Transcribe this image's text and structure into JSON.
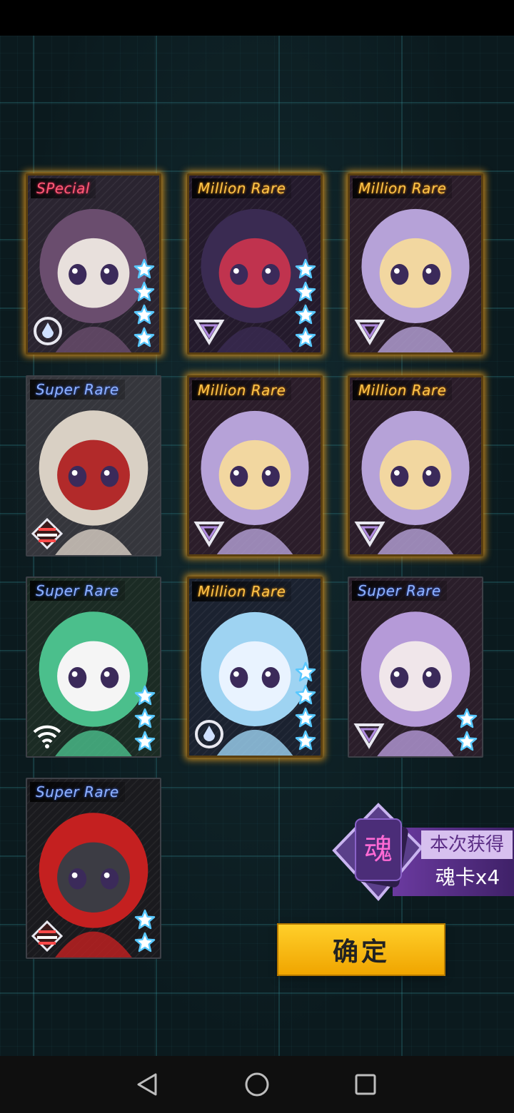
{
  "cards": [
    {
      "rarity": "SPecial",
      "rarity_class": "sp",
      "stars": 4,
      "glow": true,
      "class_icon": "drop-target-icon",
      "palette": [
        "#2a2430",
        "#6a4d6e",
        "#e8e0dc"
      ]
    },
    {
      "rarity": "Million Rare",
      "rarity_class": "mr",
      "stars": 4,
      "glow": true,
      "class_icon": "triangle-rank-icon",
      "palette": [
        "#241a2c",
        "#3a2b52",
        "#c0334e"
      ]
    },
    {
      "rarity": "Million Rare",
      "rarity_class": "mr",
      "stars": 0,
      "glow": true,
      "class_icon": "triangle-rank-icon",
      "palette": [
        "#2b1d2a",
        "#b6a2d8",
        "#f2d7a0"
      ]
    },
    {
      "rarity": "Super Rare",
      "rarity_class": "sr",
      "stars": 0,
      "glow": false,
      "class_icon": "stripes-icon",
      "palette": [
        "#35363c",
        "#d9d0c4",
        "#b22a2a"
      ]
    },
    {
      "rarity": "Million Rare",
      "rarity_class": "mr",
      "stars": 0,
      "glow": true,
      "class_icon": "triangle-rank-icon",
      "palette": [
        "#2b1d2a",
        "#b6a2d8",
        "#f2d7a0"
      ]
    },
    {
      "rarity": "Million Rare",
      "rarity_class": "mr",
      "stars": 0,
      "glow": true,
      "class_icon": "triangle-rank-icon",
      "palette": [
        "#2b1d2a",
        "#b6a2d8",
        "#f2d7a0"
      ]
    },
    {
      "rarity": "Super Rare",
      "rarity_class": "sr",
      "stars": 3,
      "glow": false,
      "class_icon": "wifi-signal-icon",
      "palette": [
        "#1b2b24",
        "#4bbf8c",
        "#f5f5f5"
      ]
    },
    {
      "rarity": "Million Rare",
      "rarity_class": "mr",
      "stars": 4,
      "glow": true,
      "class_icon": "drop-target-icon",
      "palette": [
        "#1b2230",
        "#9ed3f2",
        "#e9f3ff"
      ]
    },
    {
      "rarity": "Super Rare",
      "rarity_class": "sr",
      "stars": 2,
      "glow": false,
      "class_icon": "triangle-rank-icon",
      "palette": [
        "#2a1e2a",
        "#b59ad8",
        "#f0e6ea"
      ]
    },
    {
      "rarity": "Super Rare",
      "rarity_class": "sr",
      "stars": 2,
      "glow": false,
      "class_icon": "stripes-icon",
      "palette": [
        "#1a1a1e",
        "#c42020",
        "#3c3c44"
      ]
    }
  ],
  "soul_badge": {
    "glyph": "魂",
    "label": "本次获得",
    "reward": "魂卡x4"
  },
  "confirm_label": "确定",
  "colors": {
    "accent_gold": "#ffc400",
    "star_blue": "#58c8ff",
    "soul_purple": "#6b3aa0"
  },
  "nav": {
    "back": "back-icon",
    "home": "home-icon",
    "recents": "recents-icon"
  }
}
